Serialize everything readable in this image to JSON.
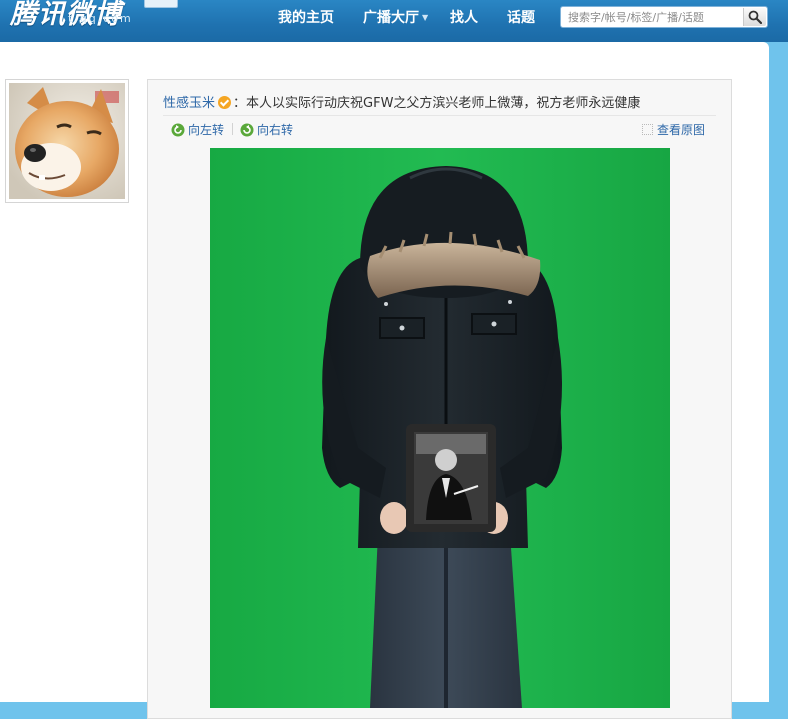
{
  "header": {
    "logo_text": "腾讯微博",
    "logo_sub": "t.qq.com",
    "nav": {
      "home": "我的主页",
      "plaza": "广播大厅",
      "people": "找人",
      "topic": "话题"
    },
    "search": {
      "placeholder": "搜索字/帐号/标签/广播/话题"
    }
  },
  "post": {
    "author": "性感玉米",
    "separator": "：",
    "text": "本人以实际行动庆祝GFW之父方滨兴老师上微薄，祝方老师永远健康",
    "actions": {
      "rotate_left": "向左转",
      "rotate_right": "向右转",
      "view_original": "查看原图"
    }
  },
  "icons": [
    "search-icon",
    "verified-icon",
    "rotate-left-icon",
    "rotate-right-icon",
    "expand-icon"
  ],
  "colors": {
    "header": "#1f72b0",
    "link": "#2e68a8",
    "photo_bg": "#1fb24b",
    "verified": "#f5a623"
  }
}
